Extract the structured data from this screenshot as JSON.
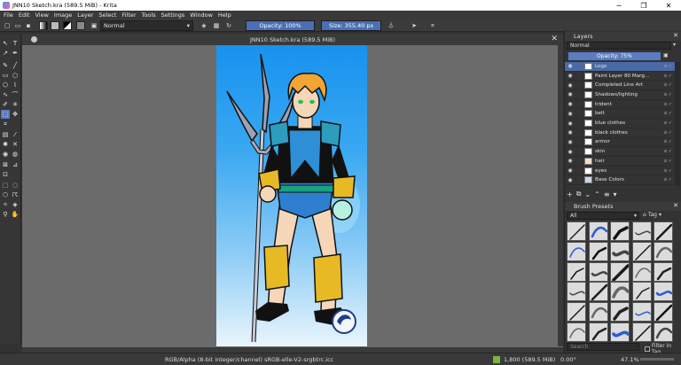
{
  "window": {
    "title": "JNN10 Sketch.kra  (589.5 MiB)  - Krita",
    "minimize": "─",
    "maximize": "❐",
    "close": "✕"
  },
  "menu": [
    "File",
    "Edit",
    "View",
    "Image",
    "Layer",
    "Select",
    "Filter",
    "Tools",
    "Settings",
    "Window",
    "Help"
  ],
  "toolbar": {
    "blend_mode": "Normal",
    "opacity_label": "Opacity: 100%",
    "size_label": "Size: 355.40 px"
  },
  "document": {
    "tab_title": "JNN10 Sketch.kra (589.5 MiB)",
    "tab_close": "✕"
  },
  "layers_panel": {
    "title": "Layers",
    "blend_mode": "Normal",
    "opacity_label": "Opacity:  75%",
    "layers": [
      {
        "name": "Logo",
        "selected": true
      },
      {
        "name": "Paint Layer 80 Marg...",
        "selected": false
      },
      {
        "name": "Completed Line Art",
        "selected": false
      },
      {
        "name": "Shadows/lighting",
        "selected": false
      },
      {
        "name": "trident",
        "selected": false
      },
      {
        "name": "belt",
        "selected": false
      },
      {
        "name": "blue clothes",
        "selected": false
      },
      {
        "name": "black clothes",
        "selected": false
      },
      {
        "name": "armor",
        "selected": false
      },
      {
        "name": "skin",
        "selected": false
      },
      {
        "name": "hair",
        "selected": false
      },
      {
        "name": "eyes",
        "selected": false
      },
      {
        "name": "Base Colors",
        "selected": false
      }
    ]
  },
  "brush_presets": {
    "title": "Brush Presets",
    "filter": "All",
    "tag_label": "Tag",
    "search_placeholder": "Search",
    "filter_in_tag": "Filter in Tag"
  },
  "status": {
    "color_space": "RGB/Alpha (8-bit integer/channel)  sRGB-elle-V2-srgbtrc.icc",
    "dimensions": "1,800 (589.5 MiB)",
    "rotation": "0.00°",
    "zoom": "47.1%"
  },
  "colors": {
    "accent": "#4a6fb5",
    "selected_layer": "#4a6aa6",
    "canvas_bg": "#6b6b6b"
  }
}
